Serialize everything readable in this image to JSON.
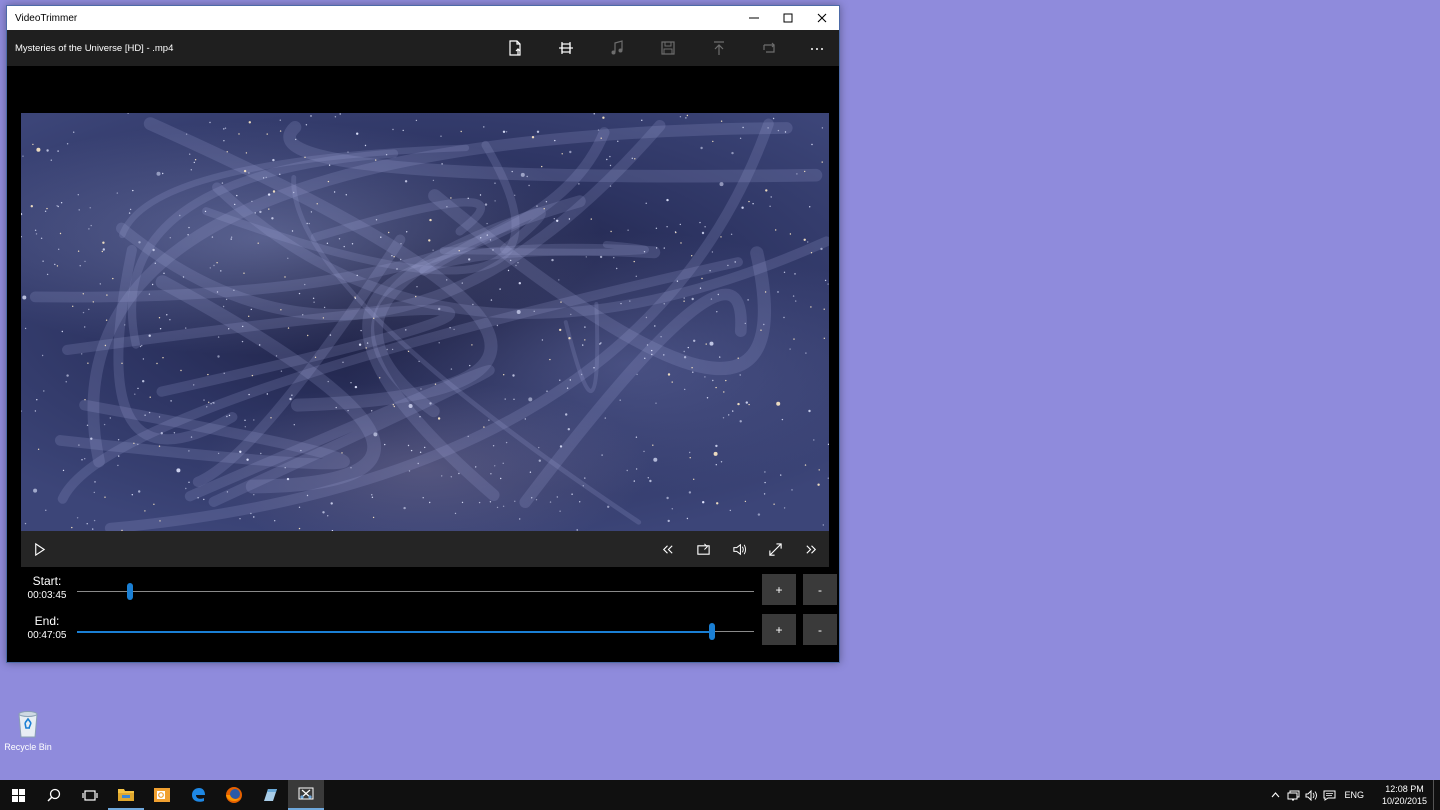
{
  "window": {
    "title": "VideoTrimmer",
    "filename": "Mysteries of the Universe [HD] - .mp4",
    "toolbar": [
      {
        "icon": "open-file-icon",
        "enabled": true
      },
      {
        "icon": "trim-icon",
        "enabled": true
      },
      {
        "icon": "music-icon",
        "enabled": false
      },
      {
        "icon": "save-icon",
        "enabled": false
      },
      {
        "icon": "upload-icon",
        "enabled": false
      },
      {
        "icon": "loop-icon",
        "enabled": false
      },
      {
        "icon": "more-icon",
        "enabled": true
      }
    ]
  },
  "player": {
    "progress": 0.0
  },
  "trim": {
    "start": {
      "label": "Start:",
      "time": "00:03:45",
      "position": 0.079
    },
    "end": {
      "label": "End:",
      "time": "00:47:05",
      "position": 0.938
    },
    "plus_label": "+",
    "minus_label": "-"
  },
  "desktop": {
    "recycle_bin_label": "Recycle Bin"
  },
  "taskbar": {
    "language": "ENG",
    "time": "12:08 PM",
    "date": "10/20/2015"
  },
  "colors": {
    "accent": "#1a7fd4",
    "desktop": "#8f8bdc",
    "appbar": "#1f1f1f"
  }
}
